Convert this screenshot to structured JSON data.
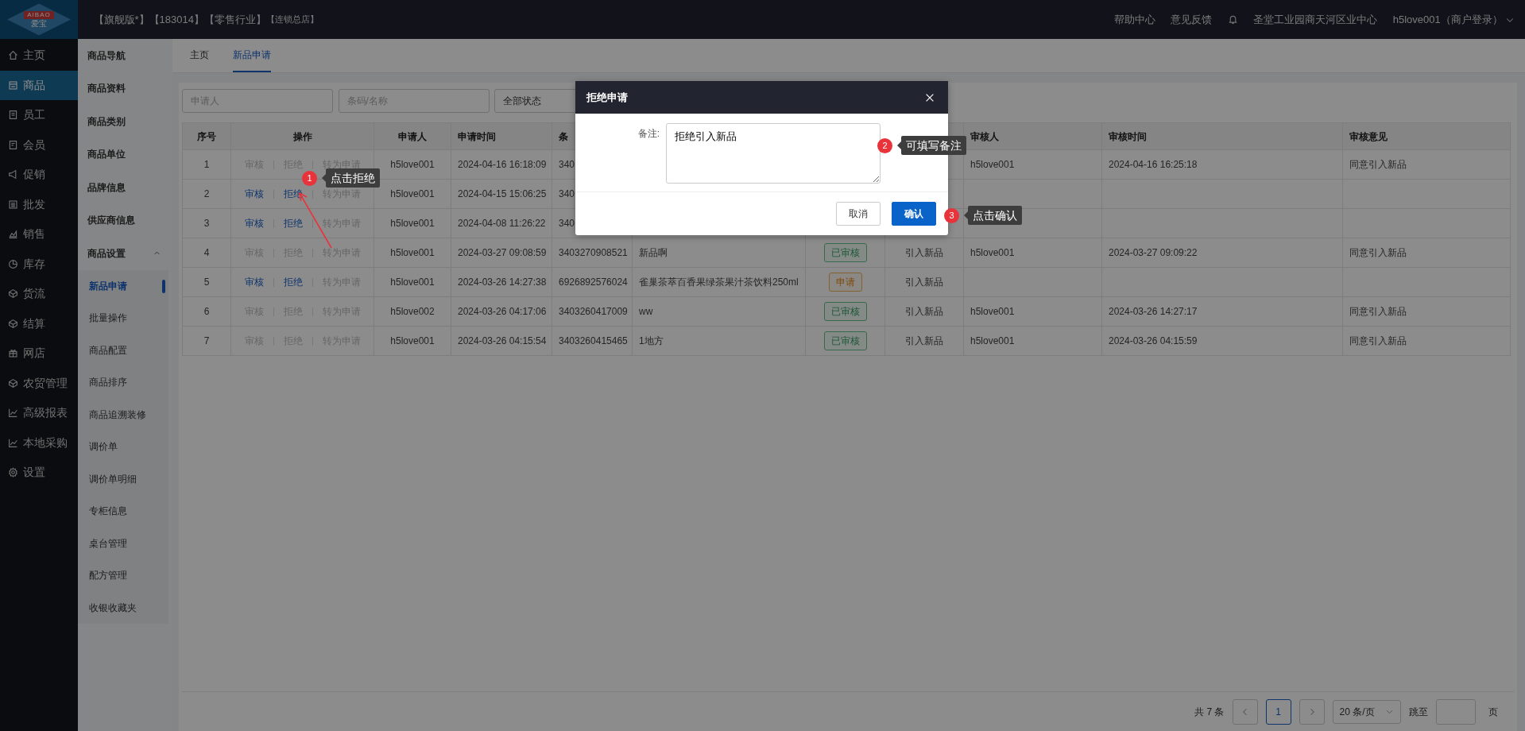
{
  "logo": {
    "text": "AIBAO",
    "subtext": "爱宝"
  },
  "top_bar": {
    "tags": [
      {
        "label": "【旗舰版*】",
        "kind": "main"
      },
      {
        "label": "【183014】",
        "kind": "main"
      },
      {
        "label": "【零售行业】",
        "kind": "main"
      },
      {
        "label": "【连锁总店】",
        "kind": "minor"
      }
    ],
    "links": [
      "帮助中心",
      "意见反馈"
    ],
    "store": "圣堂工业园商天河区业中心",
    "user": "h5love001（商户登录）"
  },
  "sidebar": {
    "items": [
      {
        "label": "主页",
        "selected": false
      },
      {
        "label": "商品",
        "selected": true
      },
      {
        "label": "员工",
        "selected": false
      },
      {
        "label": "会员",
        "selected": false
      },
      {
        "label": "促销",
        "selected": false
      },
      {
        "label": "批发",
        "selected": false
      },
      {
        "label": "销售",
        "selected": false
      },
      {
        "label": "库存",
        "selected": false
      },
      {
        "label": "货流",
        "selected": false
      },
      {
        "label": "结算",
        "selected": false
      },
      {
        "label": "网店",
        "selected": false
      },
      {
        "label": "农贸管理",
        "selected": false
      },
      {
        "label": "高级报表",
        "selected": false
      },
      {
        "label": "本地采购",
        "selected": false
      },
      {
        "label": "设置",
        "selected": false
      }
    ]
  },
  "submenu": {
    "items": [
      {
        "label": "商品导航"
      },
      {
        "label": "商品资料"
      },
      {
        "label": "商品类别"
      },
      {
        "label": "商品单位"
      },
      {
        "label": "品牌信息"
      },
      {
        "label": "供应商信息"
      },
      {
        "label": "商品设置",
        "expanded": true,
        "children": [
          {
            "label": "新品申请",
            "selected": true
          },
          {
            "label": "批量操作",
            "selected": false
          },
          {
            "label": "商品配置",
            "selected": false
          },
          {
            "label": "商品排序",
            "selected": false
          },
          {
            "label": "商品追溯装修",
            "selected": false
          },
          {
            "label": "调价单",
            "selected": false
          },
          {
            "label": "调价单明细",
            "selected": false
          },
          {
            "label": "专柜信息",
            "selected": false
          },
          {
            "label": "桌台管理",
            "selected": false
          },
          {
            "label": "配方管理",
            "selected": false
          },
          {
            "label": "收银收藏夹",
            "selected": false
          }
        ]
      }
    ]
  },
  "tabs": [
    {
      "label": "主页",
      "selected": false
    },
    {
      "label": "新品申请",
      "selected": true
    }
  ],
  "filters": {
    "applicant": {
      "placeholder": "申请人"
    },
    "code": {
      "placeholder": "条码/名称"
    },
    "status": {
      "value": "全部状态"
    }
  },
  "table": {
    "columns": [
      "序号",
      "操作",
      "申请人",
      "申请时间",
      "条",
      "",
      "",
      "",
      "审核人",
      "审核时间",
      "审核意见"
    ],
    "rows": [
      {
        "no": "1",
        "ops": [
          {
            "label": "审核",
            "enabled": false
          },
          {
            "label": "拒绝",
            "enabled": false
          },
          {
            "label": "转为申请",
            "enabled": false
          }
        ],
        "applicant": "h5love001",
        "time": "2024-04-16 16:18:09",
        "barcode": "340",
        "auditor": "h5love001",
        "audit_time": "2024-04-16 16:25:18",
        "opinion": "同意引入新品"
      },
      {
        "no": "2",
        "ops": [
          {
            "label": "审核",
            "enabled": true
          },
          {
            "label": "拒绝",
            "enabled": true
          },
          {
            "label": "转为申请",
            "enabled": false
          }
        ],
        "applicant": "h5love001",
        "time": "2024-04-15 15:06:25",
        "barcode": "340"
      },
      {
        "no": "3",
        "ops": [
          {
            "label": "审核",
            "enabled": true
          },
          {
            "label": "拒绝",
            "enabled": true
          },
          {
            "label": "转为申请",
            "enabled": false
          }
        ],
        "applicant": "h5love001",
        "time": "2024-04-08 11:26:22",
        "barcode": "340"
      },
      {
        "no": "4",
        "ops": [
          {
            "label": "审核",
            "enabled": false
          },
          {
            "label": "拒绝",
            "enabled": false
          },
          {
            "label": "转为申请",
            "enabled": false
          }
        ],
        "applicant": "h5love001",
        "time": "2024-03-27 09:08:59",
        "barcode": "3403270908521",
        "name": "新品啊",
        "status": {
          "label": "已审核",
          "kind": "approved"
        },
        "type": "引入新品",
        "auditor": "h5love001",
        "audit_time": "2024-03-27 09:09:22",
        "opinion": "同意引入新品"
      },
      {
        "no": "5",
        "ops": [
          {
            "label": "审核",
            "enabled": true
          },
          {
            "label": "拒绝",
            "enabled": true
          },
          {
            "label": "转为申请",
            "enabled": false
          }
        ],
        "applicant": "h5love001",
        "time": "2024-03-26 14:27:38",
        "barcode": "6926892576024",
        "name": "雀巢茶萃百香果绿茶果汁茶饮料250ml",
        "status": {
          "label": "申请",
          "kind": "pending"
        },
        "type": "引入新品"
      },
      {
        "no": "6",
        "ops": [
          {
            "label": "审核",
            "enabled": false
          },
          {
            "label": "拒绝",
            "enabled": false
          },
          {
            "label": "转为申请",
            "enabled": false
          }
        ],
        "applicant": "h5love002",
        "time": "2024-03-26 04:17:06",
        "barcode": "3403260417009",
        "name": "ww",
        "status": {
          "label": "已审核",
          "kind": "approved"
        },
        "type": "引入新品",
        "auditor": "h5love001",
        "audit_time": "2024-03-26 14:27:17",
        "opinion": "同意引入新品"
      },
      {
        "no": "7",
        "ops": [
          {
            "label": "审核",
            "enabled": false
          },
          {
            "label": "拒绝",
            "enabled": false
          },
          {
            "label": "转为申请",
            "enabled": false
          }
        ],
        "applicant": "h5love001",
        "time": "2024-03-26 04:15:54",
        "barcode": "3403260415465",
        "name": "1地方",
        "status": {
          "label": "已审核",
          "kind": "approved"
        },
        "type": "引入新品",
        "auditor": "h5love001",
        "audit_time": "2024-03-26 04:15:59",
        "opinion": "同意引入新品"
      }
    ]
  },
  "pagination": {
    "total": "共 7 条",
    "pages": [
      {
        "label": "1",
        "selected": true
      }
    ],
    "page_size": "20 条/页",
    "jump_label": "跳至",
    "page_suffix": "页"
  },
  "modal": {
    "title": "拒绝申请",
    "label": "备注:",
    "value": "拒绝引入新品",
    "buttons": [
      {
        "label": "取消",
        "kind": "secondary"
      },
      {
        "label": "确认",
        "kind": "primary"
      }
    ]
  },
  "callouts": [
    {
      "number": "1",
      "text": "点击拒绝"
    },
    {
      "number": "2",
      "text": "可填写备注"
    },
    {
      "number": "3",
      "text": "点击确认"
    }
  ]
}
